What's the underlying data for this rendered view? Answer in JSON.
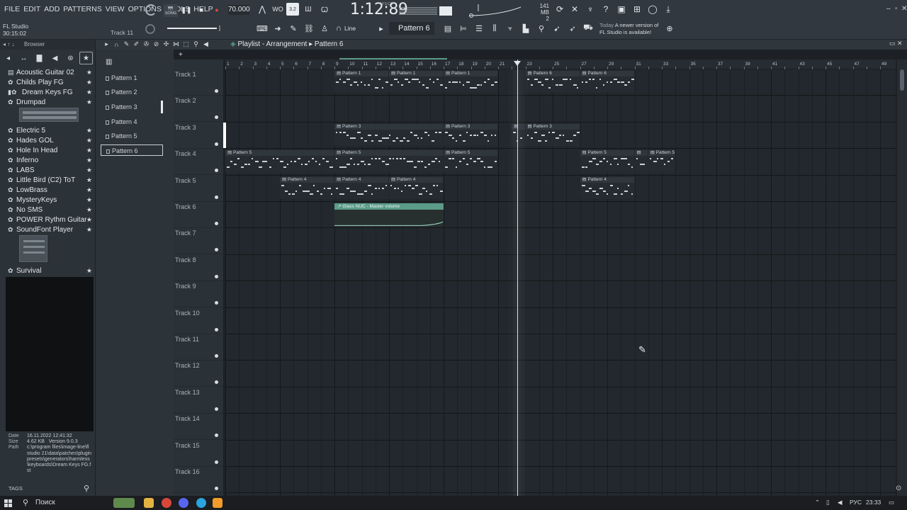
{
  "menu": [
    "FILE",
    "EDIT",
    "ADD",
    "PATTERNS",
    "VIEW",
    "OPTIONS",
    "TOOLS",
    "HELP"
  ],
  "app": {
    "name": "FL Studio",
    "time_elapsed": "30:15:02",
    "hint_track": "Track 11"
  },
  "transport": {
    "pat_label": "PAT",
    "song_label": "SONG",
    "tempo": "70.000",
    "clock": "1:12:89",
    "clock_label": "M:S:CS",
    "step_value": "3.2",
    "memory_mb": "141 MB",
    "memory_extra": "2"
  },
  "toolbar2": {
    "snap": "Line",
    "pattern": "Pattern 6"
  },
  "news": {
    "line1_label": "Today",
    "line1": "A newer version of",
    "line2": "FL Studio is available!"
  },
  "browser": {
    "header": "Browser",
    "items": [
      {
        "label": "Acoustic Guitar 02"
      },
      {
        "label": "Childs Play FG"
      },
      {
        "label": "Dream Keys FG"
      },
      {
        "label": "Drumpad"
      },
      {
        "label": "Electric 5"
      },
      {
        "label": "Hades GOL"
      },
      {
        "label": "Hole In Head"
      },
      {
        "label": "Inferno"
      },
      {
        "label": "LABS"
      },
      {
        "label": "Little Bird (C2) ToT"
      },
      {
        "label": "LowBrass"
      },
      {
        "label": "MysteryKeys"
      },
      {
        "label": "No SMS"
      },
      {
        "label": "POWER Rythm Guitar"
      },
      {
        "label": "SoundFont Player"
      },
      {
        "label": "Survival"
      }
    ],
    "info": {
      "date_label": "Date",
      "date": "16.11.2022 12:41:32",
      "size_label": "Size",
      "size": "4.62 KB",
      "version": "Version 9.0.3",
      "path_label": "Path",
      "path": "c:\\program files\\image-line\\fl studio 21\\data\\patches\\plugin presets\\generators\\harmless\\keyboards\\Dream Keys FG.fst"
    },
    "tags": "TAGS"
  },
  "picker": {
    "items": [
      "Pattern 1",
      "Pattern 2",
      "Pattern 3",
      "Pattern 4",
      "Pattern 5",
      "Pattern 6"
    ],
    "selected": 5
  },
  "playlist": {
    "title": "Playlist - Arrangement",
    "breadcrumb_sep": "▸",
    "pattern": "Pattern 6",
    "tracks": [
      "Track 1",
      "Track 2",
      "Track 3",
      "Track 4",
      "Track 5",
      "Track 6",
      "Track 7",
      "Track 8",
      "Track 9",
      "Track 10",
      "Track 11",
      "Track 12",
      "Track 13",
      "Track 14",
      "Track 15",
      "Track 16"
    ],
    "clips": [
      {
        "track": 0,
        "start": 9,
        "len": 4,
        "label": "Pattern 1"
      },
      {
        "track": 0,
        "start": 13,
        "len": 4,
        "label": "Pattern 1"
      },
      {
        "track": 0,
        "start": 17,
        "len": 4,
        "label": "Pattern 1"
      },
      {
        "track": 0,
        "start": 23,
        "len": 4,
        "label": "Pattern 6"
      },
      {
        "track": 0,
        "start": 27,
        "len": 4,
        "label": "Pattern 6"
      },
      {
        "track": 2,
        "start": 9,
        "len": 8,
        "label": "Pattern 3"
      },
      {
        "track": 2,
        "start": 17,
        "len": 4,
        "label": "Pattern 3"
      },
      {
        "track": 2,
        "start": 22,
        "len": 1,
        "label": ""
      },
      {
        "track": 2,
        "start": 23,
        "len": 4,
        "label": "Pattern 3"
      },
      {
        "track": 3,
        "start": 1,
        "len": 8,
        "label": "Pattern 5"
      },
      {
        "track": 3,
        "start": 9,
        "len": 8,
        "label": "Pattern 5"
      },
      {
        "track": 3,
        "start": 17,
        "len": 4,
        "label": "Pattern 5"
      },
      {
        "track": 3,
        "start": 27,
        "len": 4,
        "label": "Pattern 5"
      },
      {
        "track": 3,
        "start": 31,
        "len": 1,
        "label": ""
      },
      {
        "track": 3,
        "start": 32,
        "len": 2,
        "label": "Pattern 5"
      },
      {
        "track": 4,
        "start": 5,
        "len": 4,
        "label": "Pattern 4"
      },
      {
        "track": 4,
        "start": 9,
        "len": 4,
        "label": "Pattern 4"
      },
      {
        "track": 4,
        "start": 13,
        "len": 4,
        "label": "Pattern 4"
      },
      {
        "track": 4,
        "start": 27,
        "len": 4,
        "label": "Pattern 4"
      }
    ],
    "automation": {
      "track": 5,
      "start": 9,
      "len": 8,
      "label": "Glass NUC - Master volume"
    },
    "bars_visible": 49,
    "playhead_bar": 22
  },
  "taskbar": {
    "search": "Поиск",
    "lang": "РУС",
    "time": "23:33"
  },
  "colors": {
    "bg": "#1d2125",
    "panel": "#2b3238",
    "accent": "#5b9b88",
    "note": "#c9d0d6"
  }
}
